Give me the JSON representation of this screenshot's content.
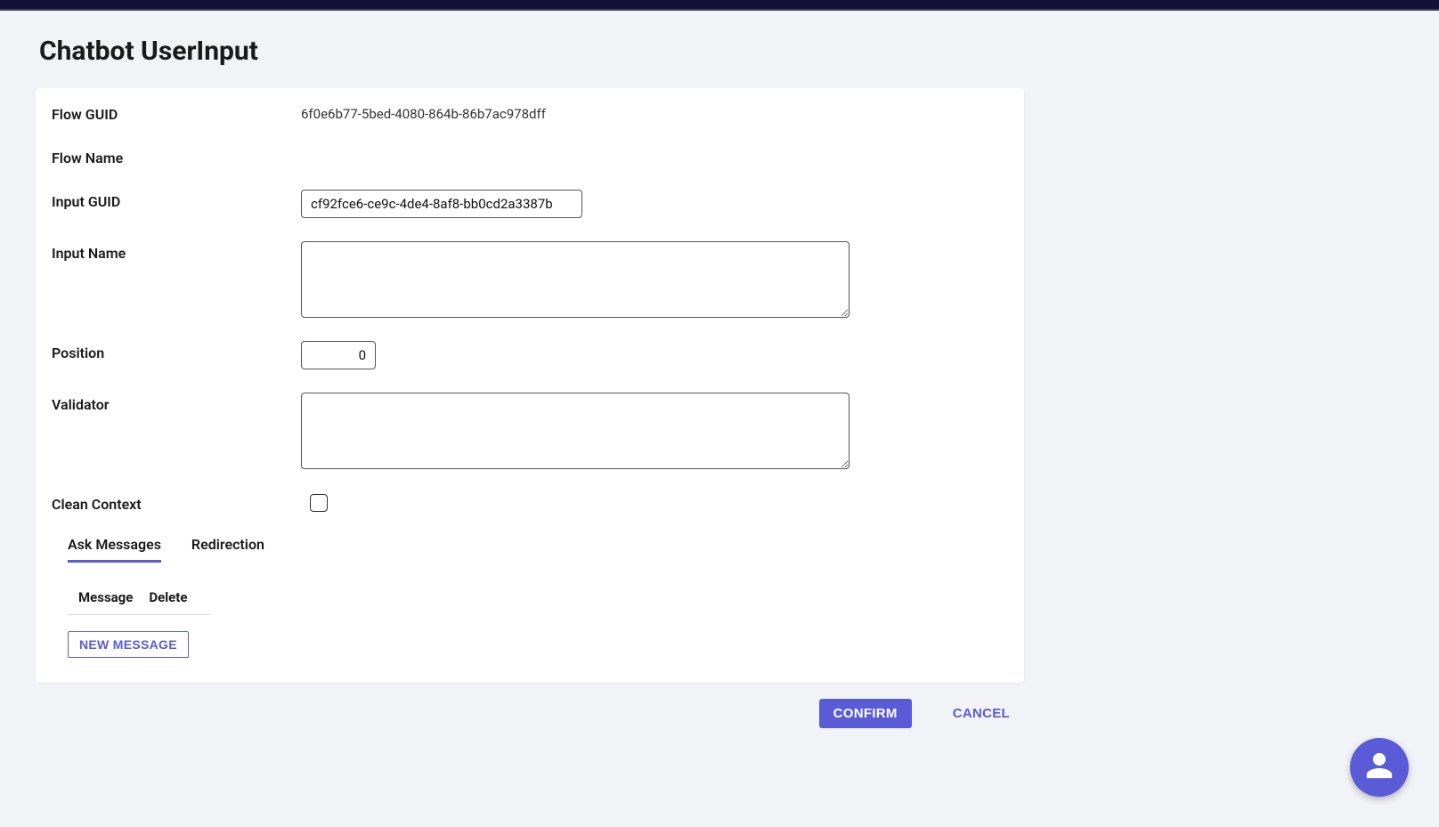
{
  "pageTitle": "Chatbot UserInput",
  "form": {
    "flowGuid": {
      "label": "Flow GUID",
      "value": "6f0e6b77-5bed-4080-864b-86b7ac978dff"
    },
    "flowName": {
      "label": "Flow Name",
      "value": ""
    },
    "inputGuid": {
      "label": "Input GUID",
      "value": "cf92fce6-ce9c-4de4-8af8-bb0cd2a3387b"
    },
    "inputName": {
      "label": "Input Name",
      "value": ""
    },
    "position": {
      "label": "Position",
      "value": "0"
    },
    "validator": {
      "label": "Validator",
      "value": ""
    },
    "cleanContext": {
      "label": "Clean Context",
      "checked": false
    }
  },
  "tabs": [
    {
      "id": "ask-messages",
      "label": "Ask Messages",
      "active": true
    },
    {
      "id": "redirection",
      "label": "Redirection",
      "active": false
    }
  ],
  "askMessages": {
    "columns": {
      "message": "Message",
      "delete": "Delete"
    },
    "newMessageLabel": "NEW MESSAGE"
  },
  "actions": {
    "confirm": "CONFIRM",
    "cancel": "CANCEL"
  },
  "fabIcon": "person-icon"
}
